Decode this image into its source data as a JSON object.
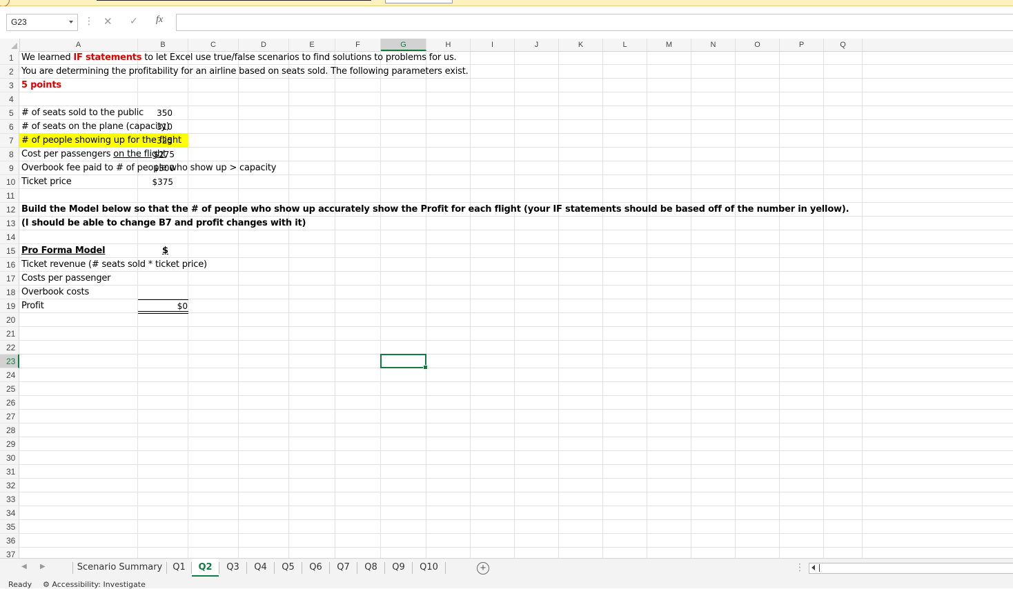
{
  "formula_bar": {
    "name_box": "G23",
    "fx_icon": "fx-icon",
    "formula": ""
  },
  "columns": [
    "A",
    "B",
    "C",
    "D",
    "E",
    "F",
    "G",
    "H",
    "I",
    "J",
    "K",
    "L",
    "M",
    "N",
    "O",
    "P",
    "Q"
  ],
  "selected_column": "G",
  "rows": [
    "1",
    "2",
    "3",
    "4",
    "5",
    "6",
    "7",
    "8",
    "9",
    "10",
    "11",
    "12",
    "13",
    "14",
    "15",
    "16",
    "17",
    "18",
    "19",
    "20",
    "21",
    "22",
    "23",
    "24",
    "25",
    "26",
    "27",
    "28",
    "29",
    "30",
    "31",
    "32",
    "33",
    "34",
    "35",
    "36",
    "37"
  ],
  "selected_row": "23",
  "sheet": {
    "r1_pre": "We learned ",
    "r1_bold": "IF statements",
    "r1_post": " to let Excel use true/false scenarios to find solutions to problems for us.",
    "r2": "You are determining the profitability for an airline based on seats sold. The following parameters exist.",
    "r3": "5 points",
    "r5": "# of seats sold to the public",
    "r6": "# of seats on the plane (capacity)",
    "r7": "# of people showing up for the flight",
    "r8_pre": "Cost per passengers ",
    "r8_u": "on the flight",
    "r9": "Overbook fee paid to # of people who show up > capacity",
    "r10": "Ticket price",
    "r12": "Build the Model below so that the # of people who show up accurately show the Profit for each flight (your IF statements should be based off of the number in yellow).",
    "r13": "(I should be able to change B7 and profit changes with it)",
    "r15": "Pro Forma Model",
    "r16": "Ticket revenue (# seats sold * ticket price)",
    "r17": "Costs per passenger",
    "r18": "Overbook costs",
    "r19": "Profit",
    "b5": "350",
    "b6": "310",
    "b7": "325",
    "b8": "$275",
    "b9": "$500",
    "b10": "$375",
    "b15": "$",
    "b19": "$0"
  },
  "tabs": [
    {
      "label": "Scenario Summary",
      "active": false
    },
    {
      "label": "Q1",
      "active": false
    },
    {
      "label": "Q2",
      "active": true
    },
    {
      "label": "Q3",
      "active": false
    },
    {
      "label": "Q4",
      "active": false
    },
    {
      "label": "Q5",
      "active": false
    },
    {
      "label": "Q6",
      "active": false
    },
    {
      "label": "Q7",
      "active": false
    },
    {
      "label": "Q8",
      "active": false
    },
    {
      "label": "Q9",
      "active": false
    },
    {
      "label": "Q10",
      "active": false
    }
  ],
  "status": {
    "ready": "Ready",
    "accessibility": "Accessibility: Investigate"
  },
  "colors": {
    "accent": "#107c41",
    "highlight": "#ffff00",
    "red_text": "#e00000"
  }
}
